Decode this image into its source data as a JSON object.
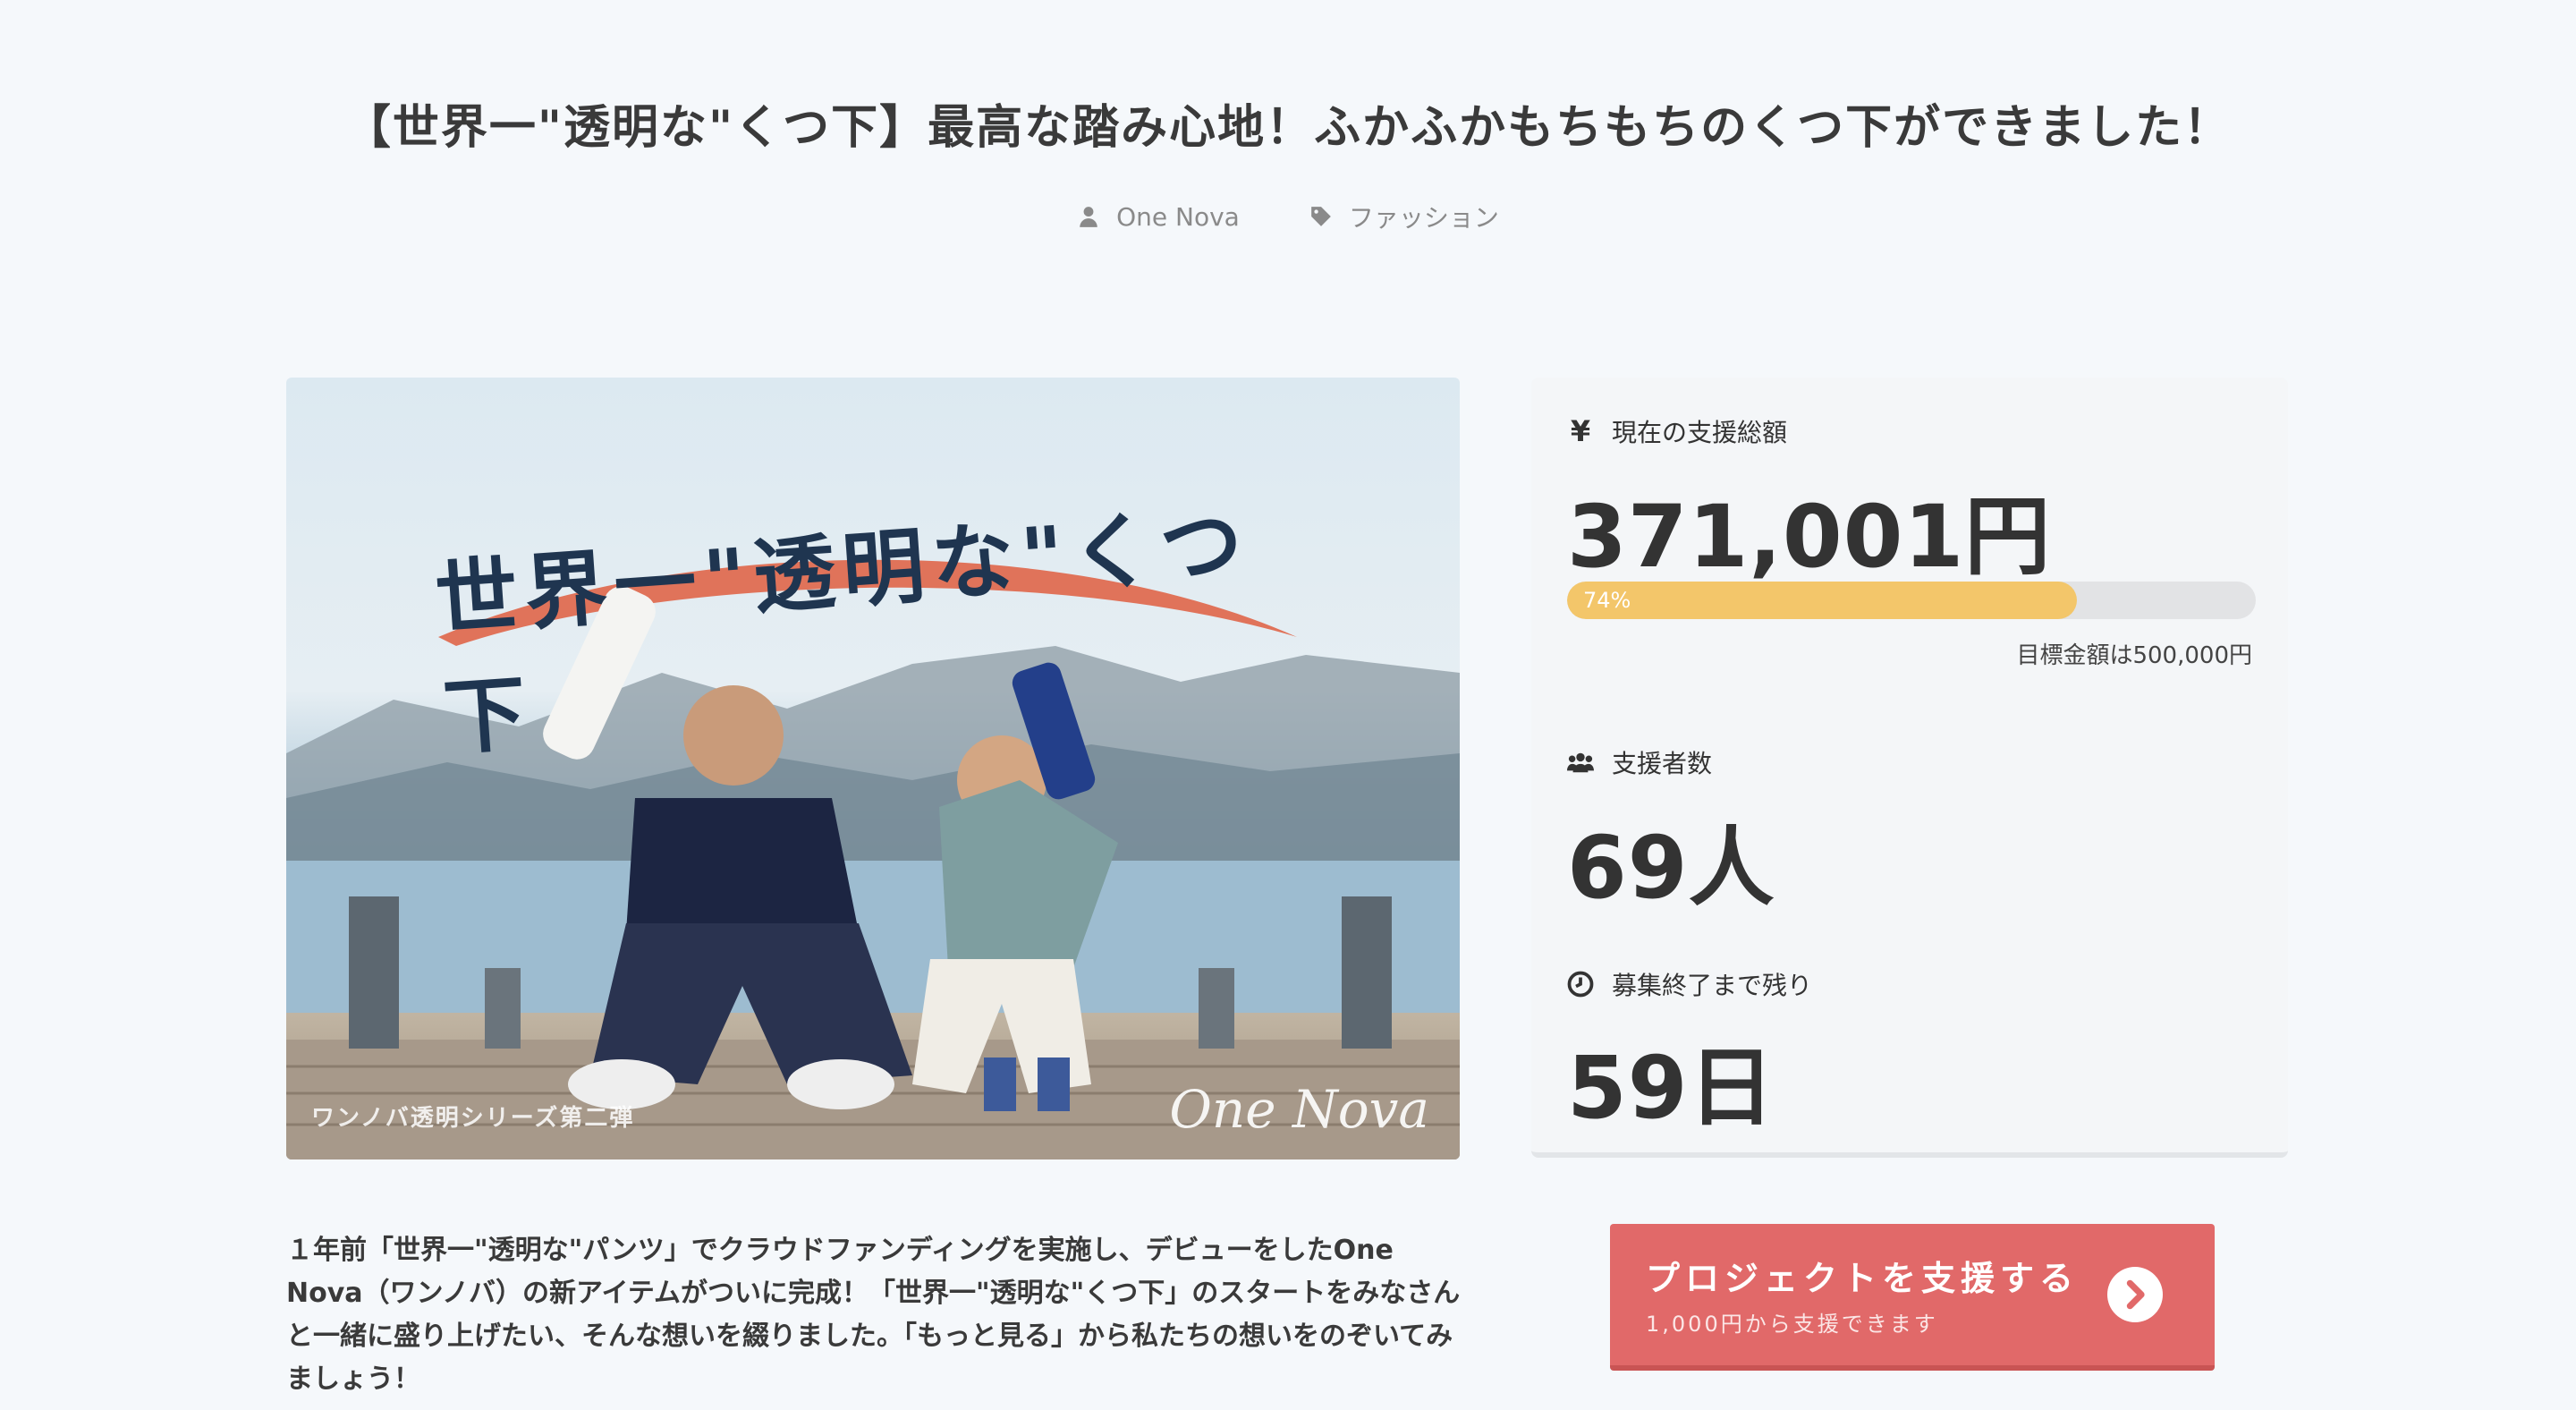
{
  "project": {
    "title": "【世界一\"透明な\"くつ下】最高な踏み心地！ふかふかもちもちのくつ下ができました！",
    "owner": "One Nova",
    "category": "ファッション"
  },
  "hero": {
    "headline": "世界一\"透明な\"くつ下",
    "series": "ワンノバ透明シリーズ第二弾",
    "logo": "One Nova"
  },
  "stats": {
    "funding_label": "現在の支援総額",
    "funding_amount": "371,001円",
    "progress_percent": 74,
    "progress_label": "74%",
    "goal_text": "目標金額は500,000円",
    "supporters_label": "支援者数",
    "supporters_count": "69人",
    "remaining_label": "募集終了まで残り",
    "remaining_days": "59日"
  },
  "description": "１年前「世界一\"透明な\"パンツ」でクラウドファンディングを実施し、デビューをしたOne Nova（ワンノバ）の新アイテムがついに完成！「世界一\"透明な\"くつ下」のスタートをみなさんと一緒に盛り上げたい、そんな想いを綴りました。「もっと見る」から私たちの想いをのぞいてみましょう！",
  "support_button": {
    "label": "プロジェクトを支援する",
    "sub": "1,000円から支援できます"
  },
  "colors": {
    "accent": "#e16969",
    "progress": "#f3c66a",
    "headline": "#1f3550",
    "brush": "#e0735a"
  },
  "icons": {
    "owner": "user-icon",
    "category": "tag-icon",
    "funding": "yen-icon",
    "supporters": "users-icon",
    "remaining": "clock-icon",
    "support": "chevron-right-circle-icon"
  }
}
